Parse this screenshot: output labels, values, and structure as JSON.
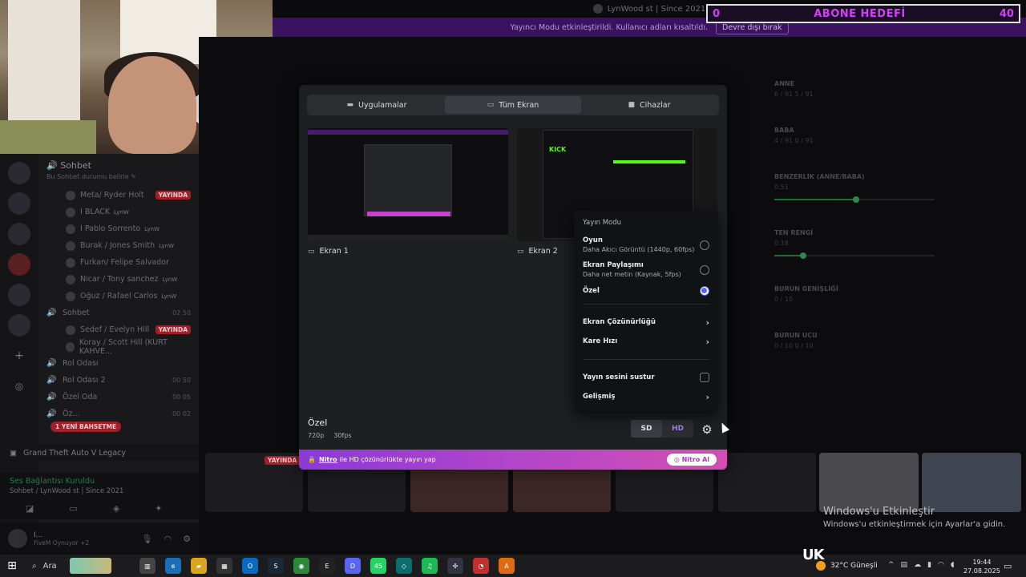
{
  "window": {
    "title": "LynWood st | Since 2021",
    "min": "—",
    "max": "☐",
    "close": "✕"
  },
  "banner": {
    "text": "Yayıncı Modu etkinleştirildi. Kullanıcı adları kısaltıldı.",
    "button": "Devre dışı bırak"
  },
  "goal": {
    "left": "0",
    "label": "ABONE HEDEFİ",
    "right": "40"
  },
  "sidebar": {
    "header": "Sohbet",
    "header_sub": "Bu Sohbet durumu belirle ✎",
    "rows": [
      {
        "name": "Meta/ Ryder Holt",
        "tag": "",
        "live": "YAYINDA"
      },
      {
        "name": "I BLACK",
        "tag": "LynW",
        "live": ""
      },
      {
        "name": "I Pablo Sorrento",
        "tag": "LynW",
        "live": ""
      },
      {
        "name": "Burak / Jones Smith",
        "tag": "LynW",
        "live": ""
      },
      {
        "name": "Furkan/ Felipe Salvador",
        "tag": "",
        "live": ""
      },
      {
        "name": "Nicar / Tony sanchez",
        "tag": "LynW",
        "live": ""
      },
      {
        "name": "Oğuz / Rafael Carlos",
        "tag": "LynW",
        "live": ""
      }
    ],
    "channel2": "Sohbet",
    "channel2_count": "02  50",
    "rows2": [
      {
        "name": "Sedef / Evelyn Hill",
        "live": "YAYINDA"
      },
      {
        "name": "Koray / Scott Hill (KURT KAHVE...",
        "live": ""
      }
    ],
    "voice": [
      {
        "name": "Rol Odası",
        "count": ""
      },
      {
        "name": "Rol Odası 2",
        "count": "00  50"
      },
      {
        "name": "Özel Oda",
        "count": "00  05"
      },
      {
        "name": "Öz...",
        "count": "00  02"
      }
    ],
    "new_messages": "1 YENİ BAHSETME",
    "game": "Grand Theft Auto V Legacy",
    "voice_connected": "Ses Bağlantısı Kuruldu",
    "voice_channel": "Sohbet / LynWood st | Since 2021",
    "user_name": "I...",
    "user_status": "FiveM Oynuyor +2"
  },
  "modal": {
    "tabs": [
      {
        "label": "Uygulamalar",
        "icon": "monitor-icon"
      },
      {
        "label": "Tüm Ekran",
        "icon": "screen-icon"
      },
      {
        "label": "Cihazlar",
        "icon": "camera-icon"
      }
    ],
    "screens": [
      {
        "label": "Ekran 1"
      },
      {
        "label": "Ekran 2"
      }
    ],
    "kick_logo": "KICK",
    "quality_title": "Özel",
    "quality_res": "720p",
    "quality_fps": "30fps",
    "sd": "SD",
    "hd": "HD",
    "nitro_word": "Nitro",
    "nitro_text": "ile HD çözünürlükte yayın yap",
    "nitro_button": "Nitro Al"
  },
  "popover": {
    "title": "Yayın Modu",
    "options": [
      {
        "label": "Oyun",
        "desc": "Daha Akıcı Görüntü (1440p, 60fps)",
        "selected": false
      },
      {
        "label": "Ekran Paylaşımı",
        "desc": "Daha net metin (Kaynak, 5fps)",
        "selected": false
      },
      {
        "label": "Özel",
        "desc": "",
        "selected": true
      }
    ],
    "resolution": "Ekran Çözünürlüğü",
    "framerate": "Kare Hızı",
    "mute": "Yayın sesini sustur",
    "advanced": "Gelişmiş"
  },
  "right_panel": {
    "sections": [
      {
        "title": "ANNE",
        "values": "6 / 91        5 / 91"
      },
      {
        "title": "BABA",
        "values": "4 / 91        0 / 91"
      },
      {
        "title": "BENZERLİK (ANNE/BABA)",
        "values": "0.51"
      },
      {
        "title": "TEN RENGİ",
        "values": "0.18"
      },
      {
        "title": "BURUN GENİŞLİĞİ",
        "values": "0 / 10"
      },
      {
        "title": "BURUN UCU",
        "values": "0 / 10        0 / 10"
      }
    ],
    "benzerlik": 0.51,
    "ten": 0.18
  },
  "tiles": {
    "live": "YAYINDA"
  },
  "activate": {
    "title": "Windows'u Etkinleştir",
    "sub": "Windows'u etkinleştirmek için Ayarlar'a gidin."
  },
  "taskbar": {
    "search": "Ara",
    "badge": "45",
    "uk": "UK",
    "weather": "32°C  Güneşli",
    "time": "19:44",
    "date": "27.08.2025"
  }
}
